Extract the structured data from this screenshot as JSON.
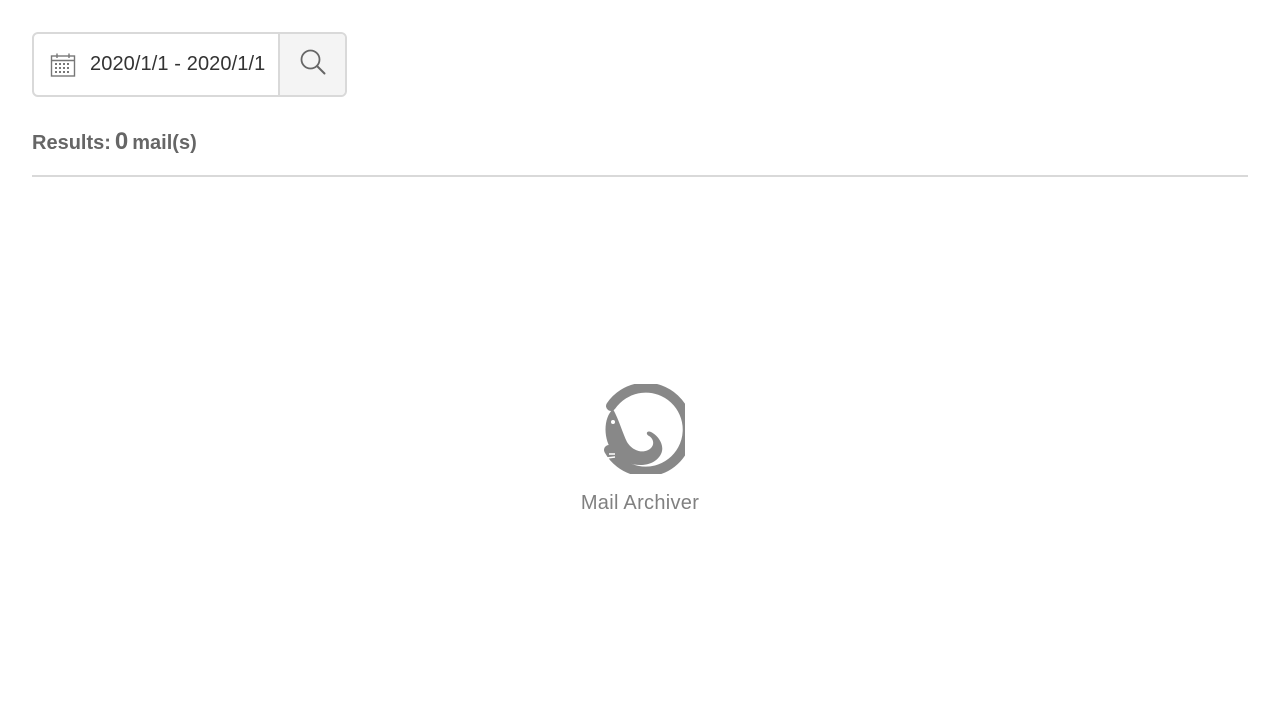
{
  "search": {
    "date_range": "2020/1/1 - 2020/1/1",
    "calendar_icon": "calendar-icon",
    "search_icon": "search-icon"
  },
  "results": {
    "prefix": "Results:",
    "count": "0",
    "suffix": "mail(s)"
  },
  "empty_state": {
    "logo_icon": "seal-logo-icon",
    "app_name": "Mail Archiver"
  },
  "colors": {
    "border": "#d9d9d9",
    "button_bg": "#f4f4f4",
    "muted_text": "#666666",
    "logo": "#888888"
  }
}
